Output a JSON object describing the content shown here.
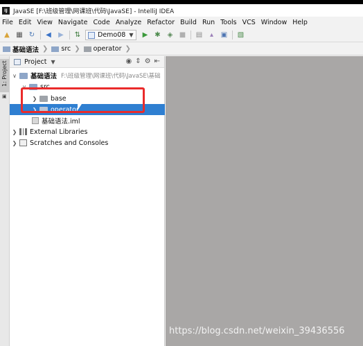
{
  "window": {
    "logo_text": "IJ",
    "title": "JavaSE [F:\\班级管理\\网课班\\代码\\JavaSE] - IntelliJ IDEA"
  },
  "menu": [
    "File",
    "Edit",
    "View",
    "Navigate",
    "Code",
    "Analyze",
    "Refactor",
    "Build",
    "Run",
    "Tools",
    "VCS",
    "Window",
    "Help"
  ],
  "toolbar": {
    "run_config": "Demo08",
    "icons": [
      "open-folder-icon",
      "save-icon",
      "sync-icon",
      "back-icon",
      "forward-icon",
      "build-icon",
      "run-icon",
      "debug-icon",
      "coverage-icon",
      "stop-icon",
      "structure-icon",
      "sdk-icon",
      "project-structure-icon"
    ]
  },
  "breadcrumb": [
    "基础语法",
    "src",
    "operator"
  ],
  "sidebar_stripe": {
    "label": "1: Project"
  },
  "project_panel": {
    "title": "Project",
    "tree": [
      {
        "label": "基础语法",
        "path": "F:\\班级管理\\网课班\\代码\\JavaSE\\基础",
        "depth": 0,
        "expanded": true
      },
      {
        "label": "src",
        "depth": 1,
        "expanded": true
      },
      {
        "label": "base",
        "depth": 2,
        "expanded": false
      },
      {
        "label": "operator",
        "depth": 2,
        "expanded": false,
        "selected": true
      },
      {
        "label": "基础语法.iml",
        "depth": 1
      },
      {
        "label": "External Libraries",
        "depth": 0,
        "expanded": false
      },
      {
        "label": "Scratches and Consoles",
        "depth": 0,
        "expanded": false
      }
    ]
  },
  "watermark": "https://blog.csdn.net/weixin_39436556",
  "colors": {
    "selection": "#2f7fd1",
    "highlight_box": "#ea2b2b",
    "editor_bg": "#a9a7a6",
    "run_green": "#3c9a3c"
  }
}
